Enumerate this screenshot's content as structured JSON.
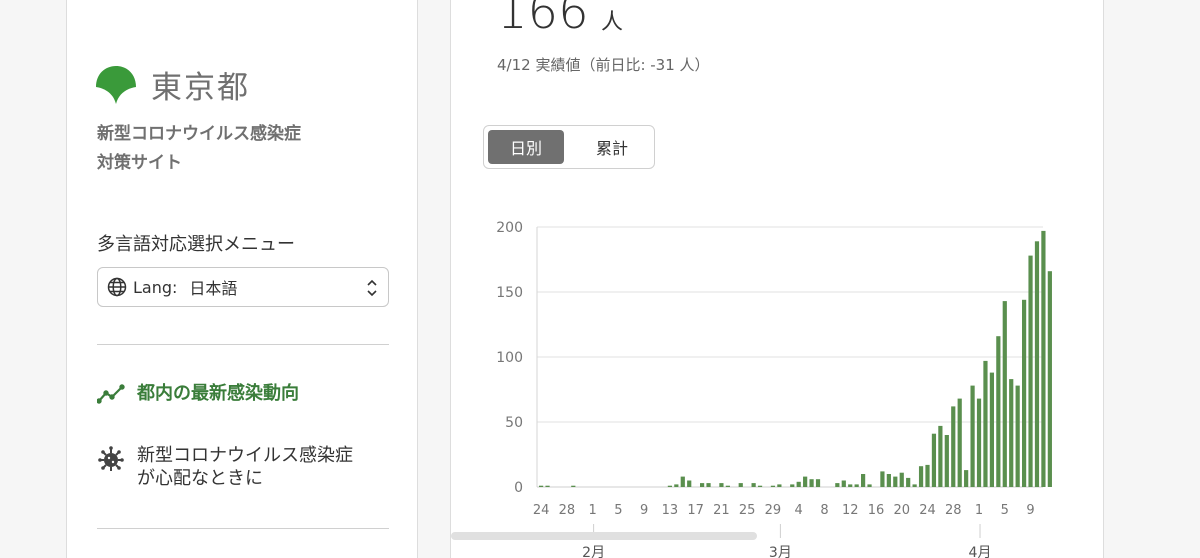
{
  "sidebar": {
    "logo_text": "東京都",
    "site_title_line1": "新型コロナウイルス感染症",
    "site_title_line2": "対策サイト",
    "lang_menu_label": "多言語対応選択メニュー",
    "lang_prefix": "Lang:",
    "lang_value": "日本語",
    "nav": [
      {
        "label": "都内の最新感染動向",
        "icon": "trend-chart-icon",
        "active": true
      },
      {
        "label_line1": "新型コロナウイルス感染症",
        "label_line2": "が心配なときに",
        "icon": "virus-icon",
        "active": false
      }
    ],
    "brand_color": "#3a9a3a"
  },
  "card": {
    "big_value": "166",
    "big_unit": "人",
    "sub_line": "4/12 実績値（前日比: -31 人）",
    "toggle": {
      "daily": "日別",
      "cumulative": "累計",
      "selected": "daily"
    }
  },
  "chart_data": {
    "type": "bar",
    "bar_color": "#5a8f4e",
    "ylim": [
      0,
      200
    ],
    "yticks": [
      0,
      50,
      100,
      150,
      200
    ],
    "grid": true,
    "x_tick_labels": [
      "24",
      "28",
      "1",
      "5",
      "9",
      "13",
      "17",
      "21",
      "25",
      "29",
      "4",
      "8",
      "12",
      "16",
      "20",
      "24",
      "28",
      "1",
      "5",
      "9"
    ],
    "month_labels": [
      "2月",
      "3月",
      "4月"
    ],
    "values": [
      1,
      1,
      0,
      0,
      0,
      1,
      0,
      0,
      0,
      0,
      0,
      0,
      0,
      0,
      0,
      0,
      0,
      0,
      0,
      0,
      1,
      2,
      8,
      5,
      0,
      3,
      3,
      0,
      3,
      1,
      0,
      3,
      0,
      3,
      1,
      0,
      1,
      2,
      0,
      2,
      4,
      8,
      6,
      6,
      0,
      0,
      3,
      5,
      2,
      2,
      10,
      2,
      0,
      12,
      10,
      8,
      11,
      7,
      2,
      16,
      17,
      41,
      47,
      40,
      62,
      68,
      13,
      78,
      68,
      97,
      88,
      116,
      143,
      83,
      78,
      144,
      178,
      189,
      197,
      166
    ]
  }
}
